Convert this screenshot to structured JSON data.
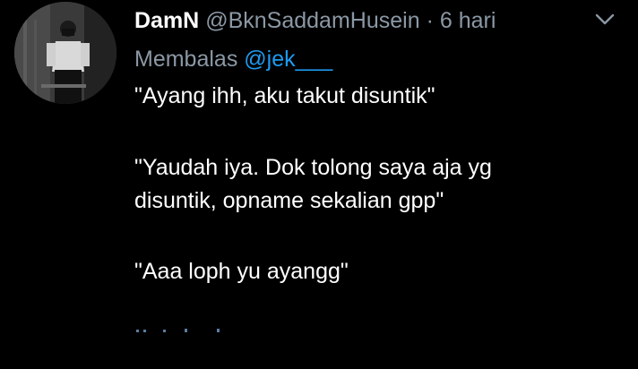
{
  "tweet": {
    "author": {
      "display_name": "DamN",
      "handle": "@BknSaddamHusein",
      "avatar_icon": "user-avatar"
    },
    "separator": "·",
    "timestamp": "6 hari",
    "menu_icon": "chevron-down-icon",
    "reply_prefix": "Membalas",
    "reply_to": "@jek___",
    "lines": [
      "\"Ayang ihh, aku takut disuntik\"",
      "\"Yaudah iya. Dok tolong saya aja yg",
      "disuntik, opname sekalian gpp\"",
      "\"Aaa loph yu ayangg\""
    ]
  },
  "colors": {
    "background": "#000000",
    "text_primary": "#ffffff",
    "text_secondary": "#8b98a5",
    "accent": "#1d9bf0"
  }
}
